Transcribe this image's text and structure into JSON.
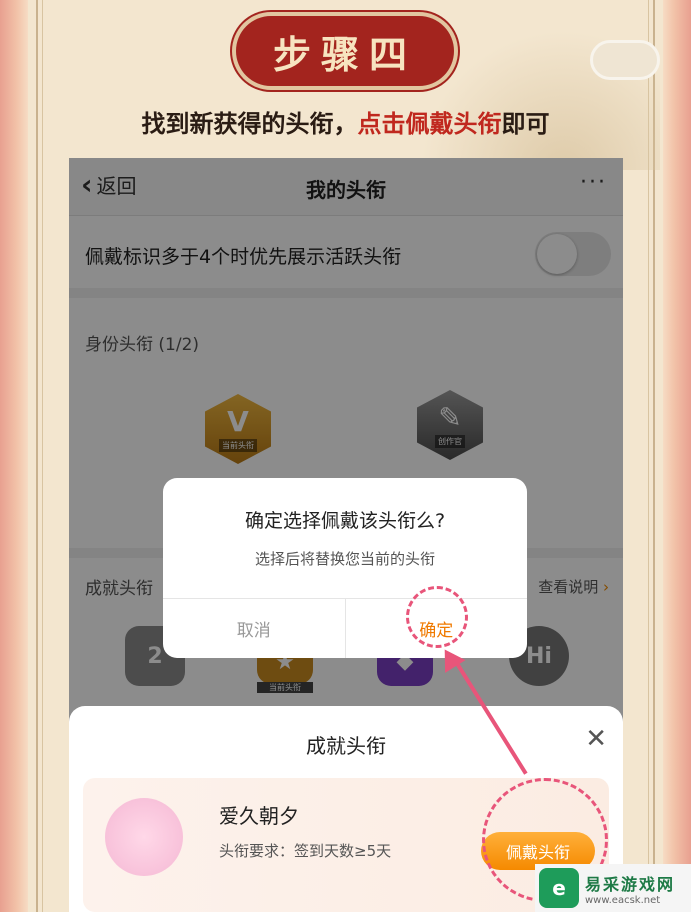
{
  "header": {
    "step_title": "步骤四",
    "instruction_prefix": "找到新获得的头衔，",
    "instruction_highlight": "点击佩戴头衔",
    "instruction_suffix": "即可"
  },
  "nav": {
    "back_label": "返回",
    "title": "我的头衔",
    "more": "···"
  },
  "settings": {
    "toggle_label": "佩戴标识多于4个时优先展示活跃头衔",
    "toggle_on": false
  },
  "identity_section": {
    "heading": "身份头衔 (1/2)",
    "badges": [
      {
        "glyph": "V",
        "caption": "当前头衔"
      },
      {
        "glyph": "✎",
        "caption": "创作官"
      }
    ]
  },
  "achievement_section": {
    "heading": "成就头衔",
    "link": "查看说明",
    "link_arrow": "›",
    "badges": [
      {
        "glyph": "2"
      },
      {
        "glyph": "★",
        "caption": "当前头衔"
      },
      {
        "glyph": "◆"
      },
      {
        "glyph": "Hi"
      }
    ]
  },
  "dialog": {
    "title": "确定选择佩戴该头衔么?",
    "message": "选择后将替换您当前的头衔",
    "cancel": "取消",
    "confirm": "确定"
  },
  "sheet": {
    "title": "成就头衔",
    "close": "✕",
    "card": {
      "name": "爱久朝夕",
      "requirement": "头衔要求：签到天数≥5天",
      "button": "佩戴头衔"
    }
  },
  "watermark": {
    "logo": "e",
    "name": "易采游戏网",
    "url": "www.eacsk.net"
  },
  "colors": {
    "accent": "#f58a00",
    "annotation": "#e8557a",
    "seal": "#a3241e",
    "highlight_text": "#c0281e"
  }
}
